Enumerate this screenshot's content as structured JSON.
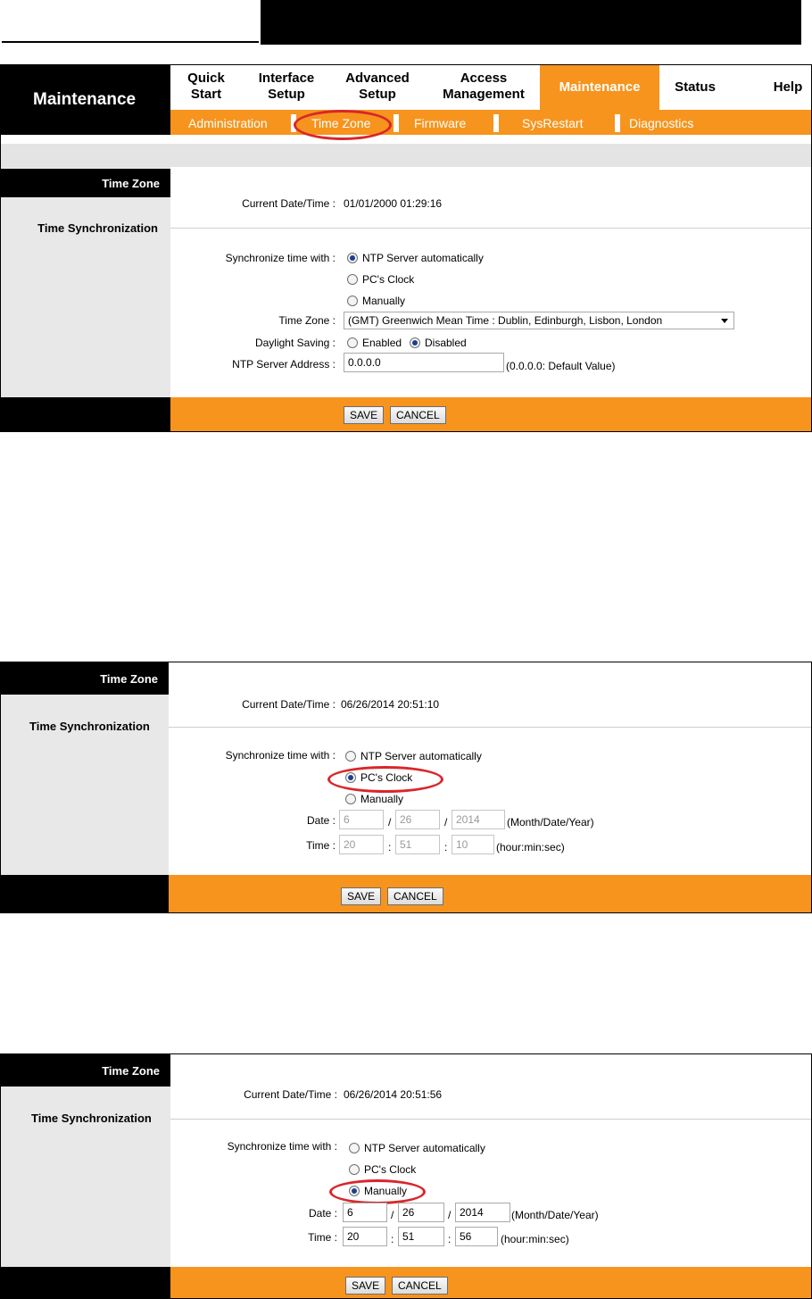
{
  "nav": {
    "brand": "Maintenance",
    "tabs": [
      {
        "label": "Quick\nStart"
      },
      {
        "label": "Interface\nSetup"
      },
      {
        "label": "Advanced\nSetup"
      },
      {
        "label": "Access\nManagement"
      },
      {
        "label": "Maintenance",
        "active": true
      },
      {
        "label": "Status"
      },
      {
        "label": "Help"
      }
    ],
    "subtabs": [
      "Administration",
      "Time Zone",
      "Firmware",
      "SysRestart",
      "Diagnostics"
    ]
  },
  "panel1": {
    "section_time_zone": "Time Zone",
    "section_time_sync": "Time Synchronization",
    "current_label": "Current Date/Time :",
    "current_value": "01/01/2000 01:29:16",
    "sync_label": "Synchronize time with :",
    "opt_ntp": "NTP Server automatically",
    "opt_pc": "PC's Clock",
    "opt_manual": "Manually",
    "selected": "ntp",
    "tz_label": "Time Zone :",
    "tz_value": "(GMT) Greenwich Mean Time : Dublin, Edinburgh, Lisbon, London",
    "dst_label": "Daylight Saving :",
    "dst_enabled": "Enabled",
    "dst_disabled": "Disabled",
    "dst_selected": "disabled",
    "ntp_label": "NTP Server Address :",
    "ntp_value": "0.0.0.0",
    "ntp_hint": "(0.0.0.0: Default Value)",
    "save": "SAVE",
    "cancel": "CANCEL"
  },
  "panel2": {
    "section_time_zone": "Time Zone",
    "section_time_sync": "Time Synchronization",
    "current_label": "Current Date/Time :",
    "current_value": "06/26/2014 20:51:10",
    "sync_label": "Synchronize time with :",
    "opt_ntp": "NTP Server automatically",
    "opt_pc": "PC's Clock",
    "opt_manual": "Manually",
    "selected": "pc",
    "date_label": "Date :",
    "date_month": "6",
    "date_day": "26",
    "date_year": "2014",
    "date_hint": "(Month/Date/Year)",
    "time_label": "Time :",
    "time_hour": "20",
    "time_min": "51",
    "time_sec": "10",
    "time_hint": "(hour:min:sec)",
    "slash": "/",
    "colon": ":",
    "save": "SAVE",
    "cancel": "CANCEL"
  },
  "panel3": {
    "section_time_zone": "Time Zone",
    "section_time_sync": "Time Synchronization",
    "current_label": "Current Date/Time :",
    "current_value": "06/26/2014 20:51:56",
    "sync_label": "Synchronize time with :",
    "opt_ntp": "NTP Server automatically",
    "opt_pc": "PC's Clock",
    "opt_manual": "Manually",
    "selected": "manual",
    "date_label": "Date :",
    "date_month": "6",
    "date_day": "26",
    "date_year": "2014",
    "date_hint": "(Month/Date/Year)",
    "time_label": "Time :",
    "time_hour": "20",
    "time_min": "51",
    "time_sec": "56",
    "time_hint": "(hour:min:sec)",
    "slash": "/",
    "colon": ":",
    "save": "SAVE",
    "cancel": "CANCEL"
  },
  "colors": {
    "accent": "#f7941e",
    "highlight_circle": "#d9262b",
    "sidebar": "#e8e8e8"
  }
}
